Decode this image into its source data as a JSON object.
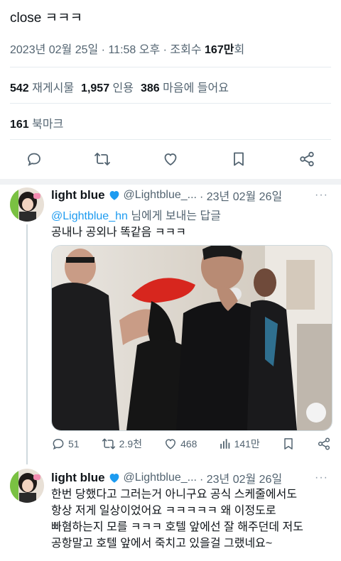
{
  "tweet": {
    "text": "close ㅋㅋㅋ",
    "meta_date": "2023년 02월 25일 · 11:58 오후 · 조회수 ",
    "meta_views": "167만",
    "meta_views_suffix": "회",
    "stats": {
      "retweets_count": "542",
      "retweets_label": "재게시물",
      "quotes_count": "1,957",
      "quotes_label": "인용",
      "likes_count": "386",
      "likes_label": "마음에 들어요"
    },
    "bookmarks_count": "161",
    "bookmarks_label": "북마크"
  },
  "actions": [
    "reply-icon",
    "retweet-icon",
    "heart-icon",
    "bookmark-icon",
    "share-icon"
  ],
  "replies": [
    {
      "name": "light blue",
      "handle": "@Lightblue_...",
      "date": "· 23년 02월 26일",
      "more": "···",
      "replying_to": "@Lightblue_hn",
      "replying_suffix": " 님에게 보내는 답글",
      "text": "공내나 공외나 똑같음 ㅋㅋㅋ",
      "counts": {
        "replies": "51",
        "retweets": "2.9천",
        "likes": "468",
        "views": "141만"
      }
    },
    {
      "name": "light blue",
      "handle": "@Lightblue_...",
      "date": "· 23년 02월 26일",
      "more": "···",
      "lines": [
        "한번 당했다고 그러는거 아니구요 공식 스케줄에서도",
        "항상 저게 일상이었어요 ㅋㅋㅋㅋㅋ 왜 이정도로",
        "빠혐하는지 모를 ㅋㅋㅋ 호텔 앞에선 잘 해주던데 저도",
        "공항말고 호텔 앞에서 죽치고 있을걸 그랬네요~"
      ]
    }
  ],
  "colors": {
    "accent": "#1d9bf0",
    "muted": "#536471",
    "text": "#0f1419"
  }
}
